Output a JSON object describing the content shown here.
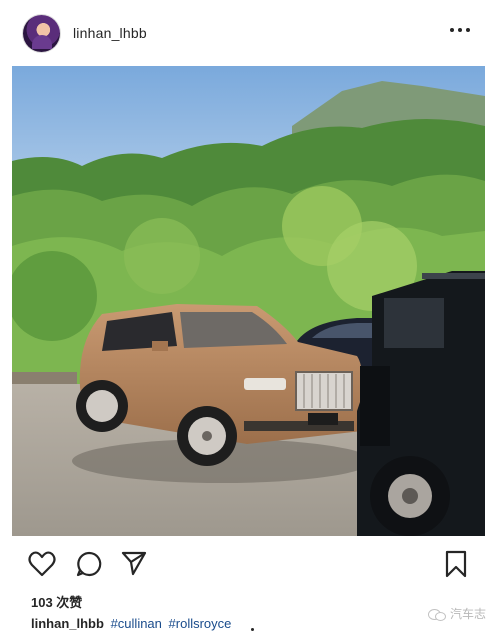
{
  "post": {
    "username": "linhan_lhbb",
    "likes_text": "103 次赞",
    "caption": {
      "username": "linhan_lhbb",
      "tags": [
        "#cullinan",
        "#rollsroyce"
      ]
    },
    "photo_description_icon": "photo"
  },
  "watermark": {
    "text": "汽车志",
    "icon": "wechat-icon"
  },
  "icons": {
    "more": "more-icon",
    "like": "heart-icon",
    "comment": "comment-icon",
    "share": "share-icon",
    "save": "bookmark-icon"
  },
  "colors": {
    "text": "#262626",
    "hashtag": "#1a4c8c",
    "sky": "#8fb7e0",
    "car_body": "#b8875f",
    "gravel": "#a9a39a"
  }
}
